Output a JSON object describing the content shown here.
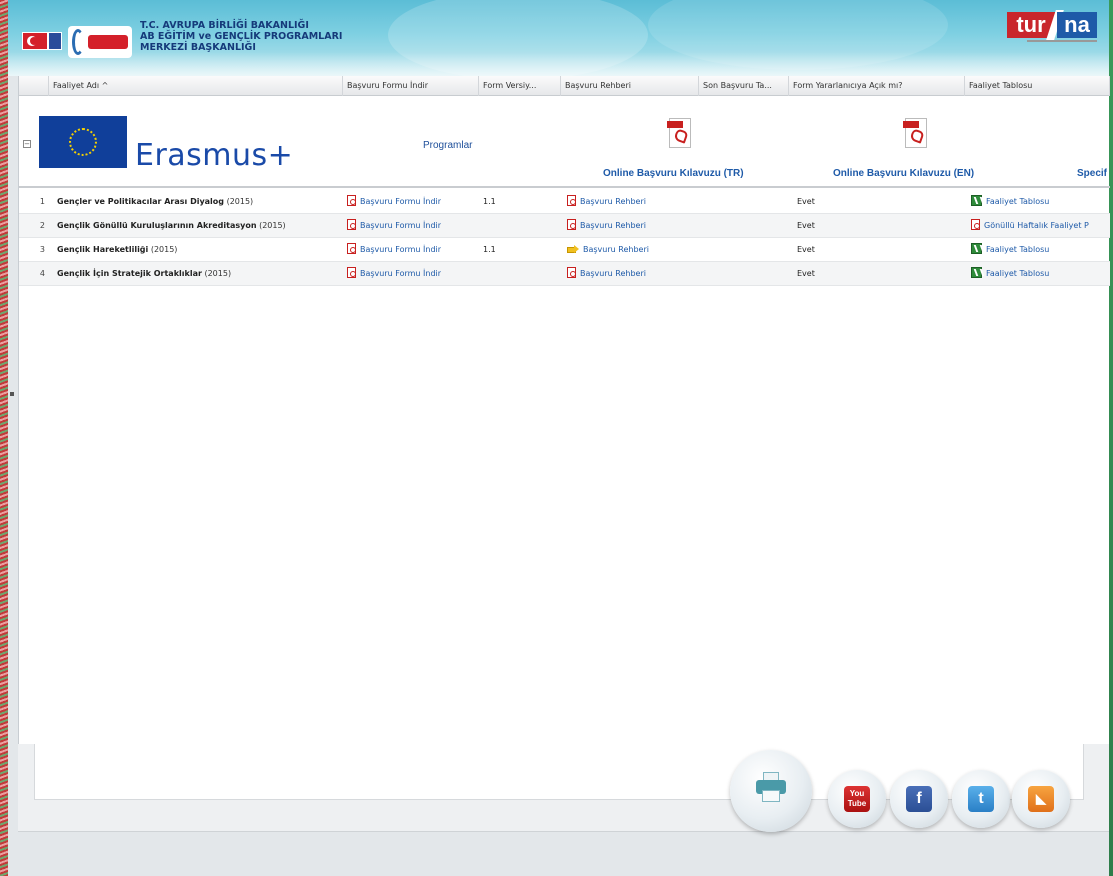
{
  "header": {
    "ministry_lines": [
      "T.C. AVRUPA BİRLİĞİ BAKANLIĞI",
      "AB EĞİTİM ve GENÇLİK PROGRAMLARI",
      "MERKEZİ BAŞKANLIĞI"
    ],
    "brand_left": "tur",
    "brand_right": "na"
  },
  "grid": {
    "columns": [
      {
        "label": "Faaliyet Adı ^"
      },
      {
        "label": "Başvuru Formu İndir"
      },
      {
        "label": "Form Versiy..."
      },
      {
        "label": "Başvuru Rehberi"
      },
      {
        "label": "Son Başvuru Ta..."
      },
      {
        "label": "Form Yararlanıcıya Açık mı?"
      },
      {
        "label": "Faaliyet Tablosu"
      }
    ],
    "group": {
      "program_name": "Erasmus+",
      "programs_label": "Programlar",
      "guide_tr_label": "Online Başvuru Kılavuzu (TR)",
      "guide_en_label": "Online Başvuru Kılavuzu (EN)",
      "guide_spec_label": "Specif"
    },
    "rows": [
      {
        "num": "1",
        "name": "Gençler ve Politikacılar Arası Diyalog",
        "year": "(2015)",
        "form": "Başvuru Formu İndir",
        "version": "1.1",
        "guide": "Başvuru Rehberi",
        "guide_icon": "pdf",
        "open": "Evet",
        "table": "Faaliyet Tablosu",
        "table_icon": "excel"
      },
      {
        "num": "2",
        "name": "Gençlik Gönüllü Kuruluşlarının Akreditasyon",
        "year": "(2015)",
        "form": "Başvuru Formu İndir",
        "version": "",
        "guide": "Başvuru Rehberi",
        "guide_icon": "pdf",
        "open": "Evet",
        "table": "Gönüllü Haftalık Faaliyet P",
        "table_icon": "pdf"
      },
      {
        "num": "3",
        "name": "Gençlik Hareketliliği",
        "year": "(2015)",
        "form": "Başvuru Formu İndir",
        "version": "1.1",
        "guide": "Başvuru Rehberi",
        "guide_icon": "arrow",
        "open": "Evet",
        "table": "Faaliyet Tablosu",
        "table_icon": "excel"
      },
      {
        "num": "4",
        "name": "Gençlik İçin Stratejik Ortaklıklar",
        "year": "(2015)",
        "form": "Başvuru Formu İndir",
        "version": "",
        "guide": "Başvuru Rehberi",
        "guide_icon": "pdf",
        "open": "Evet",
        "table": "Faaliyet Tablosu",
        "table_icon": "excel"
      }
    ]
  },
  "footer": {
    "youtube_text": "You Tube",
    "facebook_text": "f",
    "twitter_text": "t",
    "rss_text": "◣"
  }
}
